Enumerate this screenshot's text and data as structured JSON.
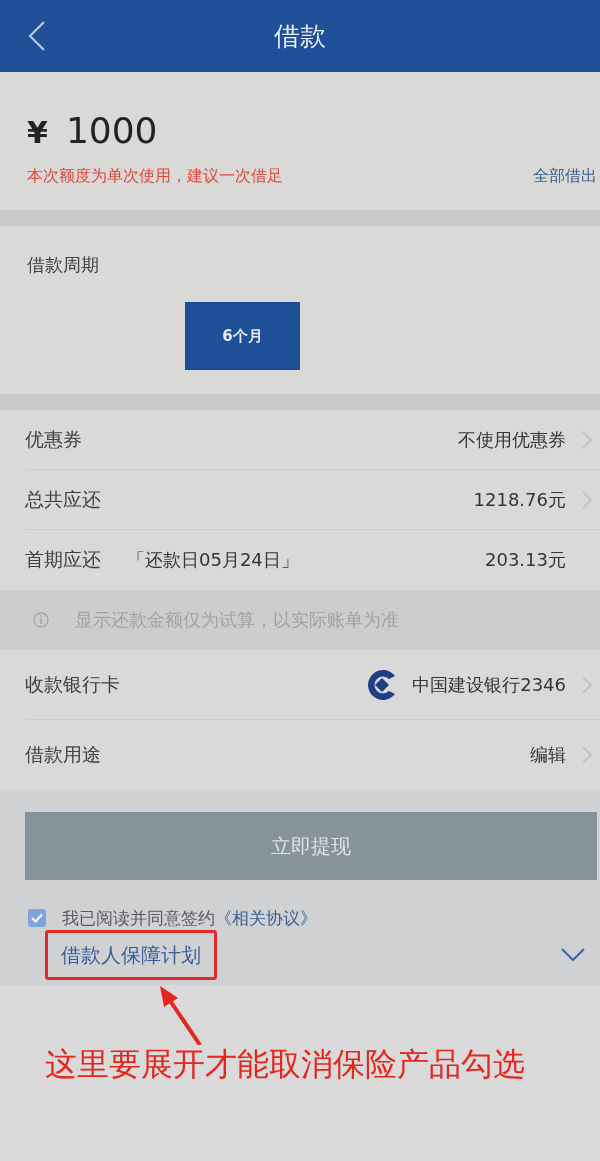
{
  "header": {
    "title": "借款"
  },
  "amount": {
    "currency": "¥",
    "value": "1000",
    "hint": "本次额度为单次使用，建议一次借足",
    "action": "全部借出"
  },
  "period": {
    "label": "借款周期",
    "options": [
      {
        "label": "6个月",
        "selected": true
      }
    ]
  },
  "summary_rows": [
    {
      "label": "优惠券",
      "value": "不使用优惠券",
      "chevron": true
    },
    {
      "label": "总共应还",
      "value": "1218.76元",
      "chevron": true
    },
    {
      "label": "首期应还",
      "note": "「还款日05月24日」",
      "value": "203.13元",
      "chevron": false
    }
  ],
  "notice": "显示还款金额仅为试算，以实际账单为准",
  "detail_rows": [
    {
      "kind": "bank",
      "label": "收款银行卡",
      "value": "中国建设银行2346",
      "chevron": true
    },
    {
      "kind": "plain",
      "label": "借款用途",
      "value": "编辑",
      "chevron": true
    }
  ],
  "submit": {
    "label": "立即提现",
    "disabled": true
  },
  "agreement": {
    "checked": true,
    "text": "我已阅读并同意签约",
    "link": "《相关协议》"
  },
  "protection_plan": {
    "label": "借款人保障计划",
    "expanded": false,
    "highlighted": true
  },
  "annotation": {
    "text": "这里要展开才能取消保险产品勾选"
  }
}
